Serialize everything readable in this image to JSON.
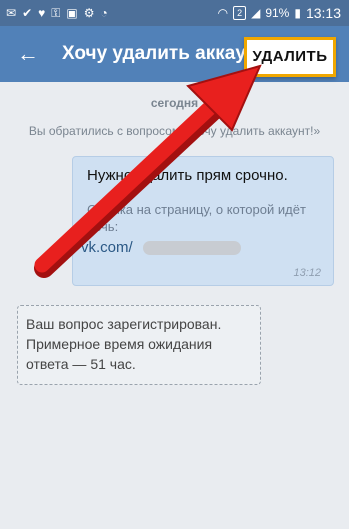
{
  "statusbar": {
    "left_icons": [
      "✉",
      "✔",
      "♥",
      "⚿",
      "▣",
      "⚙",
      "◔"
    ],
    "sim": "2",
    "battery": "91%",
    "time": "13:13"
  },
  "toolbar": {
    "back_icon": "←",
    "title": "Хочу удалить аккаунт!",
    "delete_label": "УДАЛИТЬ"
  },
  "chat": {
    "date": "сегодня",
    "system_note": "Вы обратились с вопросом «Хочу удалить аккаунт!»",
    "message": {
      "text": "Нужно удалить прям срочно.",
      "link_label": "Ссылка на страницу, о которой идёт речь:",
      "link": "vk.com/",
      "time": "13:12"
    },
    "notice": "Ваш вопрос зарегистрирован. Примерное время ожидания ответа — 51 час."
  },
  "colors": {
    "toolbar": "#5181b8",
    "statusbar": "#4c6f99",
    "bubble": "#cfe0f2",
    "arrow": "#e8201e",
    "highlight_border": "#f0a700"
  }
}
